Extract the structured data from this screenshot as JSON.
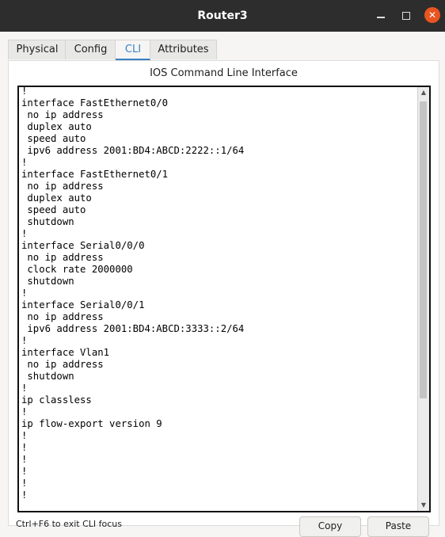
{
  "window": {
    "title": "Router3"
  },
  "tabs": [
    {
      "label": "Physical"
    },
    {
      "label": "Config"
    },
    {
      "label": "CLI"
    },
    {
      "label": "Attributes"
    }
  ],
  "active_tab": "CLI",
  "panel": {
    "title": "IOS Command Line Interface"
  },
  "terminal": {
    "lines": [
      "!",
      "interface FastEthernet0/0",
      " no ip address",
      " duplex auto",
      " speed auto",
      " ipv6 address 2001:BD4:ABCD:2222::1/64",
      "!",
      "interface FastEthernet0/1",
      " no ip address",
      " duplex auto",
      " speed auto",
      " shutdown",
      "!",
      "interface Serial0/0/0",
      " no ip address",
      " clock rate 2000000",
      " shutdown",
      "!",
      "interface Serial0/0/1",
      " no ip address",
      " ipv6 address 2001:BD4:ABCD:3333::2/64",
      "!",
      "interface Vlan1",
      " no ip address",
      " shutdown",
      "!",
      "ip classless",
      "!",
      "ip flow-export version 9",
      "!",
      "!",
      "!",
      "!",
      "!",
      "!"
    ]
  },
  "footer": {
    "hint": "Ctrl+F6 to exit CLI focus",
    "copy_label": "Copy",
    "paste_label": "Paste"
  }
}
